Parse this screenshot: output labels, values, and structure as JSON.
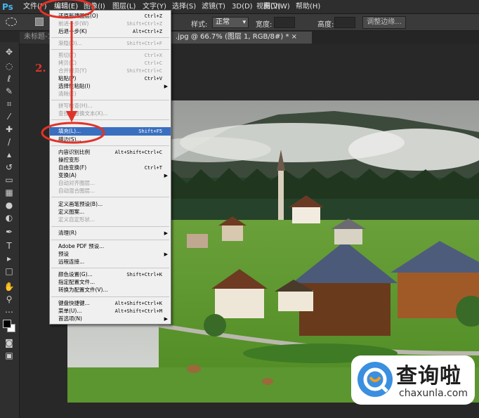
{
  "app": {
    "logo": "Ps"
  },
  "menubar": {
    "items": [
      {
        "label": "文件(F)"
      },
      {
        "label": "编辑(E)"
      },
      {
        "label": "图像(I)"
      },
      {
        "label": "图层(L)"
      },
      {
        "label": "文字(Y)"
      },
      {
        "label": "选择(S)"
      },
      {
        "label": "滤镜(T)"
      },
      {
        "label": "3D(D)"
      },
      {
        "label": "视图(V)"
      },
      {
        "label": "窗口(W)"
      },
      {
        "label": "帮助(H)"
      }
    ]
  },
  "options_bar": {
    "style_label": "样式:",
    "style_value": "正常",
    "width_label": "宽度:",
    "height_label": "高度:",
    "refine_label": "调整边缘..."
  },
  "tabs": {
    "untitled": "未标题-1",
    "current": ".jpg @ 66.7% (图层 1, RGB/8#) * ×"
  },
  "annotation": {
    "step": "2."
  },
  "edit_menu": {
    "items": [
      {
        "label": "还原新建图层(O)",
        "shortcut": "Ctrl+Z",
        "disabled": false
      },
      {
        "label": "前进一步(W)",
        "shortcut": "Shift+Ctrl+Z",
        "disabled": true
      },
      {
        "label": "后退一步(K)",
        "shortcut": "Alt+Ctrl+Z",
        "disabled": false
      },
      {
        "label": "渐隐(D)...",
        "shortcut": "Shift+Ctrl+F",
        "disabled": true
      },
      {
        "label": "剪切(T)",
        "shortcut": "Ctrl+X",
        "disabled": true
      },
      {
        "label": "拷贝(C)",
        "shortcut": "Ctrl+C",
        "disabled": true
      },
      {
        "label": "合并拷贝(Y)",
        "shortcut": "Shift+Ctrl+C",
        "disabled": true
      },
      {
        "label": "粘贴(P)",
        "shortcut": "Ctrl+V",
        "disabled": false
      },
      {
        "label": "选择性粘贴(I)",
        "shortcut": "",
        "disabled": false,
        "submenu": true
      },
      {
        "label": "清除(E)",
        "shortcut": "",
        "disabled": true
      },
      {
        "label": "拼写检查(H)...",
        "shortcut": "",
        "disabled": true
      },
      {
        "label": "查找和替换文本(X)...",
        "shortcut": "",
        "disabled": true
      },
      {
        "label": "填充(L)...",
        "shortcut": "Shift+F5",
        "disabled": false,
        "highlight": true
      },
      {
        "label": "描边(S)...",
        "shortcut": "",
        "disabled": false
      },
      {
        "label": "内容识别比例",
        "shortcut": "Alt+Shift+Ctrl+C",
        "disabled": false
      },
      {
        "label": "操控变形",
        "shortcut": "",
        "disabled": false
      },
      {
        "label": "自由变换(F)",
        "shortcut": "Ctrl+T",
        "disabled": false
      },
      {
        "label": "变换(A)",
        "shortcut": "",
        "disabled": false,
        "submenu": true
      },
      {
        "label": "自动对齐图层...",
        "shortcut": "",
        "disabled": true
      },
      {
        "label": "自动混合图层...",
        "shortcut": "",
        "disabled": true
      },
      {
        "label": "定义画笔预设(B)...",
        "shortcut": "",
        "disabled": false
      },
      {
        "label": "定义图案...",
        "shortcut": "",
        "disabled": false
      },
      {
        "label": "定义自定形状...",
        "shortcut": "",
        "disabled": true
      },
      {
        "label": "清理(R)",
        "shortcut": "",
        "disabled": false,
        "submenu": true
      },
      {
        "label": "Adobe PDF 预设...",
        "shortcut": "",
        "disabled": false
      },
      {
        "label": "预设",
        "shortcut": "",
        "disabled": false,
        "submenu": true
      },
      {
        "label": "远程连接...",
        "shortcut": "",
        "disabled": false
      },
      {
        "label": "颜色设置(G)...",
        "shortcut": "Shift+Ctrl+K",
        "disabled": false
      },
      {
        "label": "指定配置文件...",
        "shortcut": "",
        "disabled": false
      },
      {
        "label": "转换为配置文件(V)...",
        "shortcut": "",
        "disabled": false
      },
      {
        "label": "键盘快捷键...",
        "shortcut": "Alt+Shift+Ctrl+K",
        "disabled": false
      },
      {
        "label": "菜单(U)...",
        "shortcut": "Alt+Shift+Ctrl+M",
        "disabled": false
      },
      {
        "label": "首选项(N)",
        "shortcut": "",
        "disabled": false,
        "submenu": true
      }
    ]
  },
  "watermark": {
    "text": "查询啦",
    "domain": "chaxunla.com"
  },
  "colors": {
    "highlight": "#3a6fc0",
    "annotation": "#e03328",
    "ps_blue": "#43b6f0"
  }
}
